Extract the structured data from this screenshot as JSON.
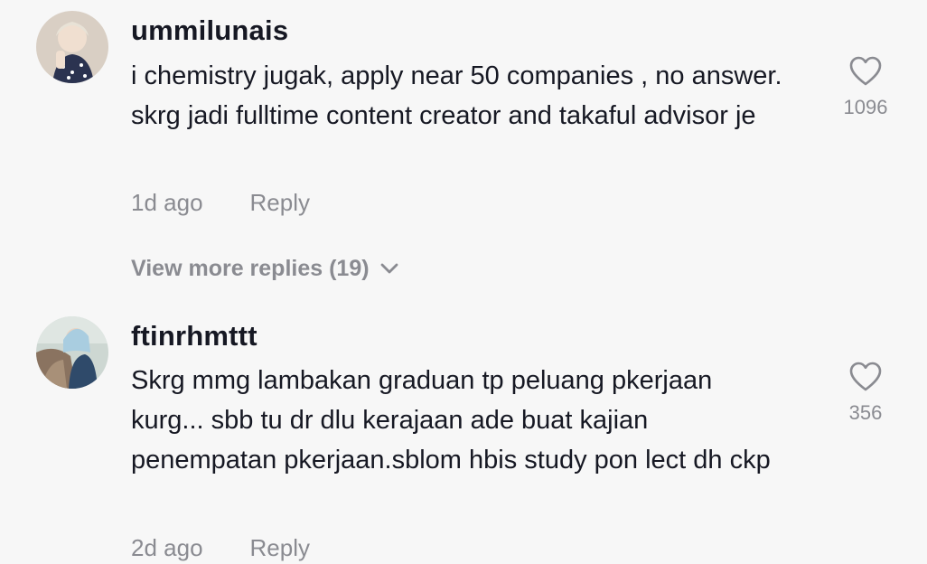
{
  "comments": [
    {
      "username": "ummilunais",
      "text": "i chemistry jugak, apply near 50 companies , no answer. skrg jadi fulltime content creator and takaful advisor je",
      "time": "1d ago",
      "reply_label": "Reply",
      "likes": "1096",
      "like_icon": "heart-outline-icon",
      "view_more": "View more replies (19)"
    },
    {
      "username": "ftinrhmttt",
      "text": "Skrg mmg lambakan graduan tp peluang pkerjaan kurg... sbb tu dr dlu kerajaan ade buat kajian penempatan pkerjaan.sblom hbis study pon lect dh ckp",
      "time": "2d ago",
      "reply_label": "Reply",
      "likes": "356",
      "like_icon": "heart-outline-icon"
    }
  ],
  "colors": {
    "background": "#f7f7f7",
    "primary_text": "#161823",
    "secondary_text": "#8a8b91"
  }
}
